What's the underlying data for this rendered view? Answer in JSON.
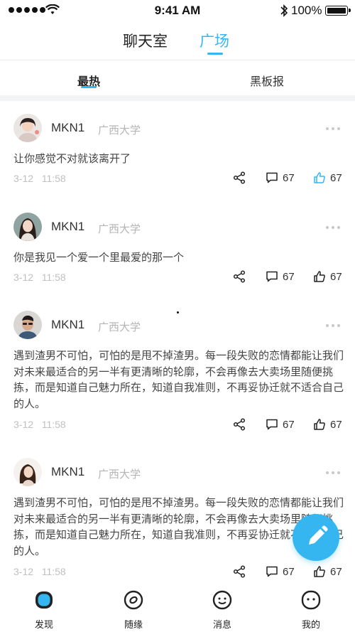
{
  "status_bar": {
    "time": "9:41 AM",
    "battery": "100%"
  },
  "top_tabs": [
    {
      "label": "聊天室",
      "active": false
    },
    {
      "label": "广场",
      "active": true
    }
  ],
  "sub_tabs": [
    {
      "label": "最热",
      "active": true
    },
    {
      "label": "黑板报",
      "active": false
    }
  ],
  "colors": {
    "accent": "#35b6f0",
    "muted": "#b5b5b5"
  },
  "posts": [
    {
      "username": "MKN1",
      "school": "广西大学",
      "text": "让你感觉不对就该离开了",
      "date": "3-12",
      "time": "11:58",
      "comments": "67",
      "likes": "67",
      "liked": true
    },
    {
      "username": "MKN1",
      "school": "广西大学",
      "text": "你是我见一个爱一个里最爱的那一个",
      "date": "3-12",
      "time": "11:58",
      "comments": "67",
      "likes": "67",
      "liked": false
    },
    {
      "username": "MKN1",
      "school": "广西大学",
      "text": "遇到渣男不可怕，可怕的是甩不掉渣男。每一段失败的恋情都能让我们对未来最适合的另一半有更清晰的轮廓，不会再像去大卖场里随便挑拣，而是知道自己魅力所在，知道自我准则，不再妥协迁就不适合自己的人。",
      "date": "3-12",
      "time": "11:58",
      "comments": "67",
      "likes": "67",
      "liked": false
    },
    {
      "username": "MKN1",
      "school": "广西大学",
      "text": "遇到渣男不可怕，可怕的是甩不掉渣男。每一段失败的恋情都能让我们对未来最适合的另一半有更清晰的轮廓，不会再像去大卖场里随便挑拣，而是知道自己魅力所在，知道自我准则，不再妥协迁就不适合自己的人。",
      "date": "3-12",
      "time": "11:58",
      "comments": "67",
      "likes": "67",
      "liked": false
    }
  ],
  "bottom_nav": [
    {
      "label": "发现",
      "icon": "discover-icon",
      "active": true
    },
    {
      "label": "随缘",
      "icon": "random-icon",
      "active": false
    },
    {
      "label": "消息",
      "icon": "message-icon",
      "active": false
    },
    {
      "label": "我的",
      "icon": "profile-icon",
      "active": false
    }
  ]
}
